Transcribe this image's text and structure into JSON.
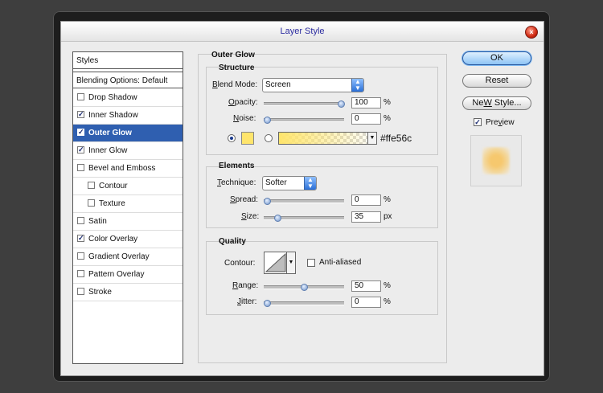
{
  "window": {
    "title": "Layer Style",
    "close_glyph": "×"
  },
  "styles_panel": {
    "header": "Styles",
    "blending_options": "Blending Options: Default",
    "items": [
      {
        "label": "Drop Shadow",
        "checked": false,
        "check": ""
      },
      {
        "label": "Inner Shadow",
        "checked": true,
        "check": "✓"
      },
      {
        "label": "Outer Glow",
        "checked": true,
        "check": "✓",
        "selected": true
      },
      {
        "label": "Inner Glow",
        "checked": true,
        "check": "✓"
      },
      {
        "label": "Bevel and Emboss",
        "checked": false,
        "check": ""
      },
      {
        "label": "Contour",
        "checked": false,
        "check": ""
      },
      {
        "label": "Texture",
        "checked": false,
        "check": ""
      },
      {
        "label": "Satin",
        "checked": false,
        "check": ""
      },
      {
        "label": "Color Overlay",
        "checked": true,
        "check": "✓"
      },
      {
        "label": "Gradient Overlay",
        "checked": false,
        "check": ""
      },
      {
        "label": "Pattern Overlay",
        "checked": false,
        "check": ""
      },
      {
        "label": "Stroke",
        "checked": false,
        "check": ""
      }
    ]
  },
  "outer_glow": {
    "title": "Outer Glow",
    "structure": {
      "title": "Structure",
      "blend_mode_label_b": "B",
      "blend_mode_label_rest": "lend Mode:",
      "blend_mode_value": "Screen",
      "opacity_label_o": "O",
      "opacity_label_rest": "pacity:",
      "opacity_value": "100",
      "opacity_percent": 100,
      "noise_label_n": "N",
      "noise_label_rest": "oise:",
      "noise_value": "0",
      "noise_percent": 0,
      "unit_percent": "%",
      "color": "#ffe56c",
      "hex_label": "#ffe56c"
    },
    "elements": {
      "title": "Elements",
      "technique_label_t": "T",
      "technique_label_rest": "echnique:",
      "technique_value": "Softer",
      "spread_label_s": "S",
      "spread_label_rest": "pread:",
      "spread_value": "0",
      "spread_percent": 0,
      "size_label_s": "S",
      "size_label_rest": "ize:",
      "size_value": "35",
      "size_percent": 14,
      "unit_px": "px"
    },
    "quality": {
      "title": "Quality",
      "contour_label": "Contour:",
      "anti_aliased_label": "Anti-aliased",
      "range_label_r": "R",
      "range_label_rest": "ange:",
      "range_value": "50",
      "range_percent": 50,
      "jitter_label_j": "J",
      "jitter_label_rest": "itter:",
      "jitter_value": "0",
      "jitter_percent": 0
    }
  },
  "buttons": {
    "ok": "OK",
    "reset": "Reset",
    "new_style_w": "W",
    "new_style_pre": "Ne",
    "new_style_post": " Style...",
    "preview_label_v": "v",
    "preview_label_pre": "Pre",
    "preview_label_post": "iew",
    "preview_checked": "✓"
  },
  "colors": {
    "selection": "#2f5fb0",
    "glow_color": "#ffe56c",
    "title_text": "#2c2ca0"
  }
}
